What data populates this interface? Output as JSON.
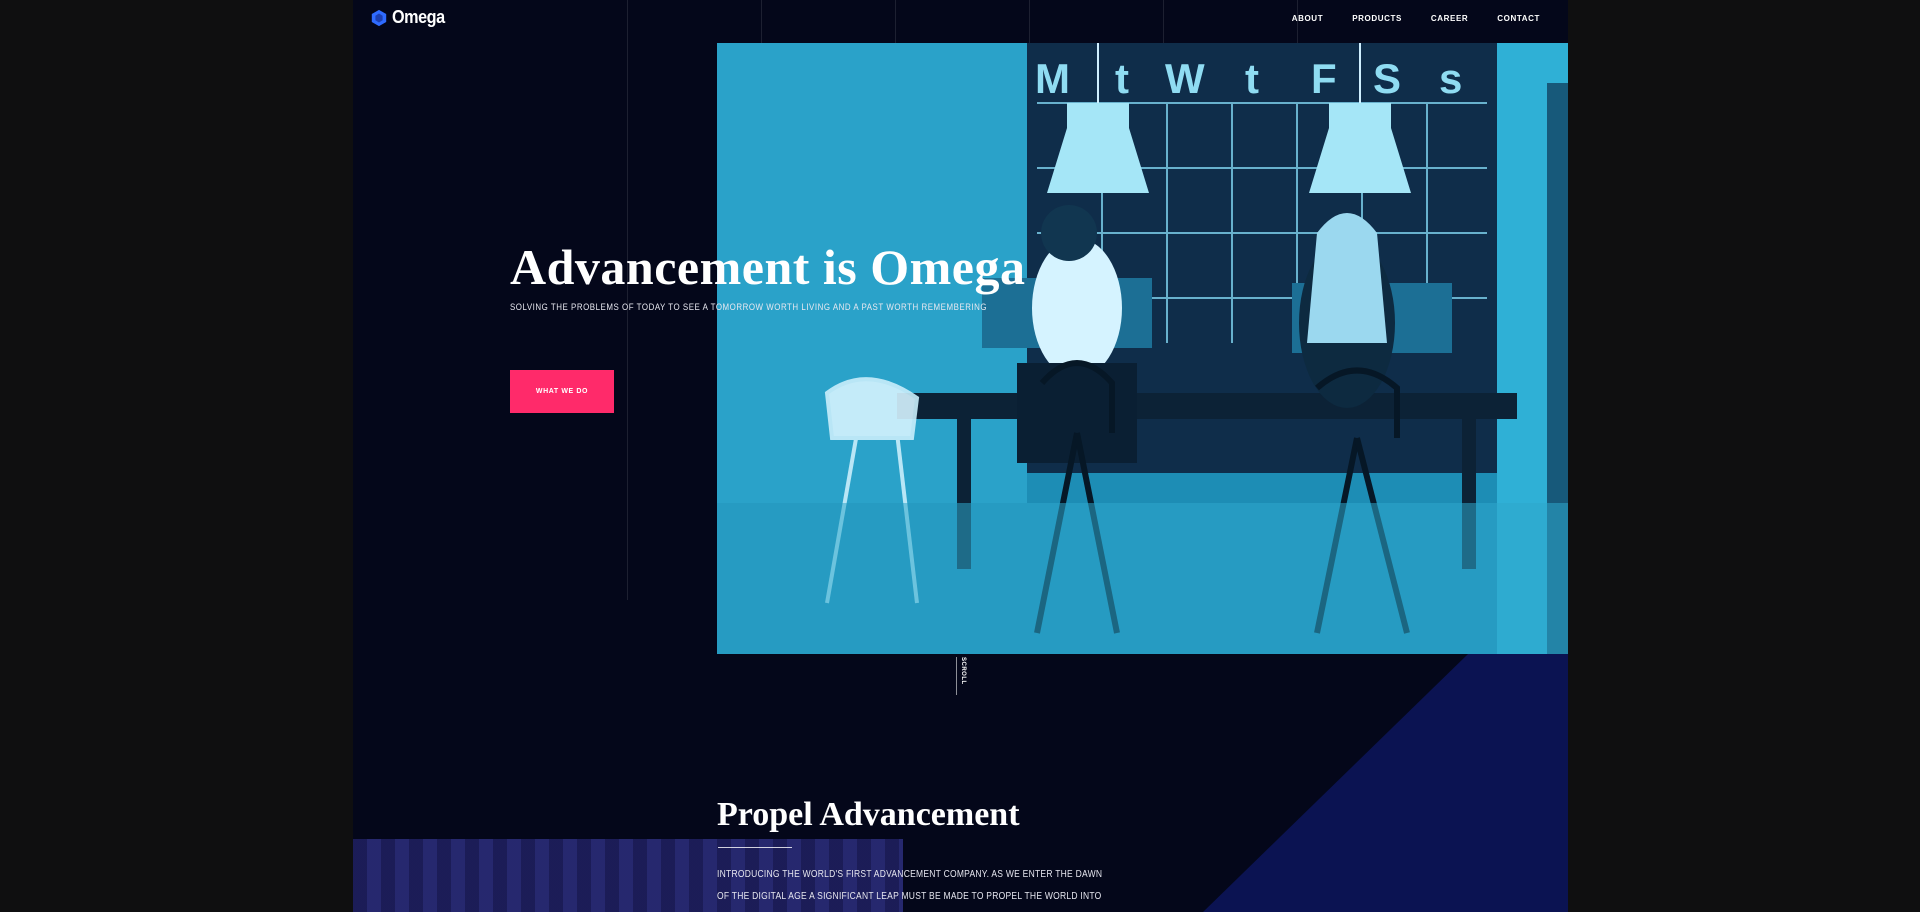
{
  "brand": {
    "name": "Omega",
    "logo_icon": "hexagon-logo-icon",
    "accent_color": "#ff2a6a",
    "photo_tint": "#1c8fb6"
  },
  "nav": {
    "items": [
      "About",
      "Products",
      "Career",
      "Contact"
    ]
  },
  "hero": {
    "title": "Advancement is Omega",
    "subtitle": "SOLVING THE PROBLEMS OF TODAY TO SEE A TOMORROW WORTH LIVING AND A PAST WORTH REMEMBERING",
    "cta_label": "WHAT WE DO",
    "photo_calendar_days": [
      "M",
      "t",
      "W",
      "t",
      "F",
      "S",
      "s"
    ]
  },
  "scroll": {
    "label": "SCROLL"
  },
  "section": {
    "title": "Propel Advancement",
    "body": "INTRODUCING THE WORLD'S FIRST ADVANCEMENT COMPANY. AS WE ENTER THE DAWN OF THE DIGITAL AGE A SIGNIFICANT LEAP MUST BE MADE TO PROPEL THE WORLD INTO THE AGE OF ADVANCEMENT."
  }
}
